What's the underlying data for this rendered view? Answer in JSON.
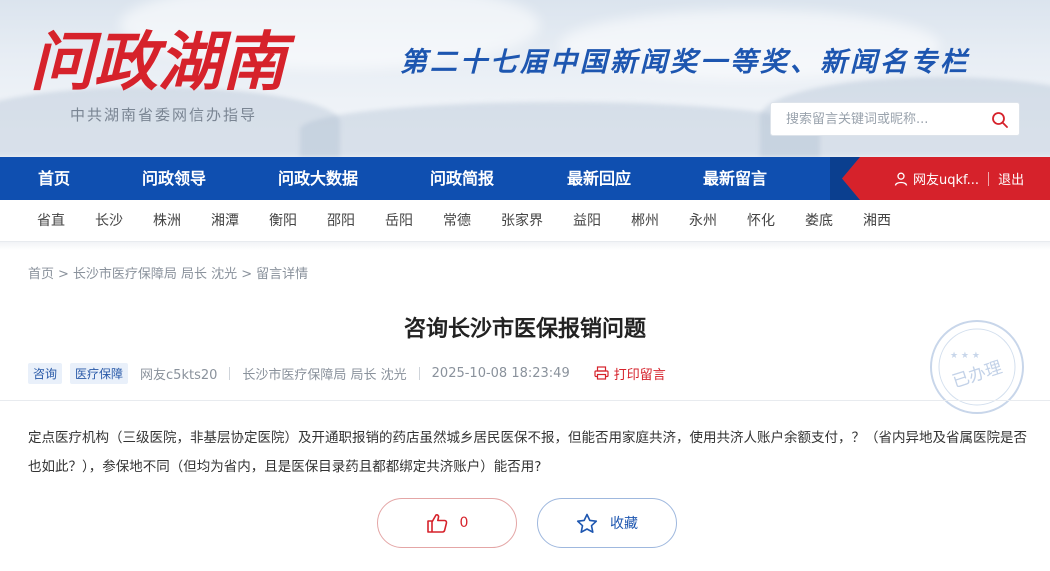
{
  "header": {
    "logo_text": "问政湖南",
    "logo_subtitle": "中共湖南省委网信办指导",
    "slogan": "第二十七届中国新闻奖一等奖、新闻名专栏",
    "search_placeholder": "搜索留言关键词或昵称...",
    "brand_red": "#d6222b",
    "brand_blue": "#0f4fb0"
  },
  "nav": {
    "items": [
      "首页",
      "问政领导",
      "问政大数据",
      "问政简报",
      "最新回应",
      "最新留言"
    ],
    "user_label": "网友uqkf...",
    "logout_label": "退出"
  },
  "regions": [
    "省直",
    "长沙",
    "株洲",
    "湘潭",
    "衡阳",
    "邵阳",
    "岳阳",
    "常德",
    "张家界",
    "益阳",
    "郴州",
    "永州",
    "怀化",
    "娄底",
    "湘西"
  ],
  "breadcrumb": [
    "首页",
    "长沙市医疗保障局 局长 沈光",
    "留言详情"
  ],
  "post": {
    "title": "咨询长沙市医保报销问题",
    "tags": [
      "咨询",
      "医疗保障"
    ],
    "author": "网友c5kts20",
    "department": "长沙市医疗保障局 局长 沈光",
    "datetime": "2025-10-08 18:23:49",
    "print_label": "打印留言",
    "stamp_text": "已办理",
    "body": "定点医疗机构（三级医院，非基层协定医院）及开通职报销的药店虽然城乡居民医保不报，但能否用家庭共济，使用共济人账户余额支付，？（省内异地及省属医院是否也如此？），参保地不同（但均为省内，且是医保目录药且都都绑定共济账户）能否用?"
  },
  "actions": {
    "like_count": "0",
    "favorite_label": "收藏"
  }
}
